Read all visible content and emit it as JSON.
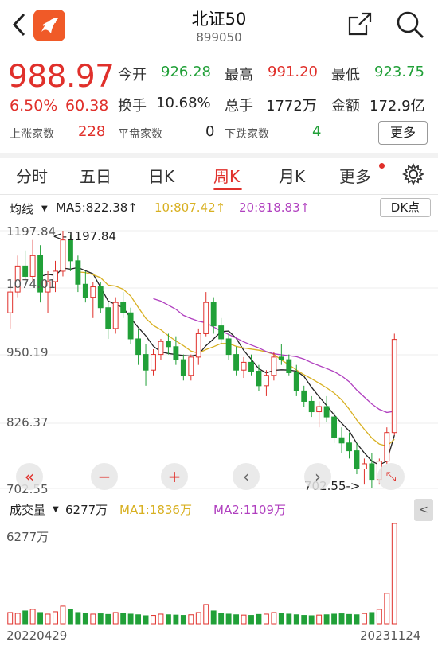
{
  "header": {
    "title": "北证50",
    "code": "899050"
  },
  "quote": {
    "price": "988.97",
    "change_pct": "6.50%",
    "change_abs": "60.38",
    "open_label": "今开",
    "open": "926.28",
    "high_label": "最高",
    "high": "991.20",
    "low_label": "最低",
    "low": "923.75",
    "turnover_label": "换手",
    "turnover": "10.68%",
    "volume_label": "总手",
    "volume": "1772万",
    "amount_label": "金额",
    "amount": "172.9亿",
    "up_label": "上涨家数",
    "up": "228",
    "flat_label": "平盘家数",
    "flat": "0",
    "down_label": "下跌家数",
    "down": "4",
    "more_label": "更多"
  },
  "tabs": [
    "分时",
    "五日",
    "日K",
    "周K",
    "月K",
    "更多"
  ],
  "active_tab": "周K",
  "indicators": {
    "selector": "均线",
    "ma5": "MA5:822.38↑",
    "ma10": "10:807.42↑",
    "ma20": "20:818.83↑",
    "dk": "DK点"
  },
  "chart_labels": {
    "y_top": "1197.84",
    "y2": "1074.01",
    "y3": "950.19",
    "y4": "826.37",
    "y_bottom": "702.55",
    "max_note": "<-1197.84",
    "min_note": "702.55->"
  },
  "volume": {
    "selector": "成交量",
    "value": "6277万",
    "ma1": "MA1:1836万",
    "ma2": "MA2:1109万",
    "axis_top": "6277万",
    "arrow": "<"
  },
  "dates": {
    "start": "20220429",
    "end": "20231124"
  },
  "controls": {
    "first": "«",
    "zoom_out": "−",
    "zoom_in": "+",
    "prev": "‹",
    "next": "›"
  },
  "colors": {
    "up": "#e0302b",
    "down": "#21a038",
    "ma5": "#222222",
    "ma10": "#d8b021",
    "ma20": "#b03fbf"
  },
  "chart_data": {
    "type": "candlestick",
    "ylim": [
      702.55,
      1197.84
    ],
    "ohlc": [
      [
        1040,
        1090,
        1010,
        1080
      ],
      [
        1080,
        1150,
        1070,
        1130
      ],
      [
        1130,
        1160,
        1100,
        1110
      ],
      [
        1110,
        1180,
        1100,
        1150
      ],
      [
        1150,
        1170,
        1060,
        1080
      ],
      [
        1080,
        1120,
        1040,
        1100
      ],
      [
        1100,
        1140,
        1080,
        1120
      ],
      [
        1120,
        1197.84,
        1110,
        1180
      ],
      [
        1180,
        1190,
        1120,
        1140
      ],
      [
        1140,
        1150,
        1080,
        1095
      ],
      [
        1095,
        1120,
        1060,
        1070
      ],
      [
        1070,
        1100,
        1030,
        1090
      ],
      [
        1090,
        1100,
        1040,
        1050
      ],
      [
        1050,
        1060,
        990,
        1010
      ],
      [
        1010,
        1070,
        1000,
        1060
      ],
      [
        1060,
        1080,
        1030,
        1040
      ],
      [
        1040,
        1050,
        980,
        990
      ],
      [
        990,
        1010,
        940,
        960
      ],
      [
        960,
        980,
        900,
        930
      ],
      [
        930,
        970,
        920,
        960
      ],
      [
        960,
        990,
        950,
        985
      ],
      [
        985,
        1000,
        960,
        975
      ],
      [
        975,
        995,
        940,
        950
      ],
      [
        950,
        960,
        910,
        920
      ],
      [
        920,
        960,
        910,
        955
      ],
      [
        955,
        1010,
        940,
        1000
      ],
      [
        1000,
        1080,
        995,
        1060
      ],
      [
        1060,
        1070,
        1000,
        1015
      ],
      [
        1015,
        1030,
        980,
        990
      ],
      [
        990,
        1000,
        950,
        960
      ],
      [
        960,
        975,
        920,
        930
      ],
      [
        930,
        955,
        915,
        945
      ],
      [
        945,
        960,
        920,
        928
      ],
      [
        928,
        940,
        890,
        900
      ],
      [
        900,
        930,
        880,
        920
      ],
      [
        920,
        965,
        910,
        955
      ],
      [
        955,
        980,
        940,
        950
      ],
      [
        950,
        960,
        920,
        925
      ],
      [
        925,
        940,
        880,
        890
      ],
      [
        890,
        900,
        860,
        870
      ],
      [
        870,
        880,
        840,
        850
      ],
      [
        850,
        870,
        820,
        860
      ],
      [
        860,
        880,
        830,
        840
      ],
      [
        840,
        850,
        790,
        800
      ],
      [
        800,
        820,
        770,
        790
      ],
      [
        790,
        810,
        760,
        775
      ],
      [
        775,
        790,
        730,
        740
      ],
      [
        740,
        760,
        710,
        750
      ],
      [
        750,
        770,
        702.55,
        720
      ],
      [
        720,
        760,
        710,
        755
      ],
      [
        755,
        820,
        750,
        810
      ],
      [
        810,
        1000,
        805,
        988.97
      ]
    ],
    "volume": [
      700,
      650,
      800,
      900,
      700,
      600,
      750,
      1100,
      900,
      700,
      650,
      600,
      620,
      580,
      700,
      650,
      600,
      560,
      500,
      520,
      600,
      560,
      540,
      520,
      560,
      700,
      1200,
      800,
      650,
      600,
      560,
      540,
      520,
      580,
      600,
      700,
      650,
      600,
      560,
      520,
      500,
      540,
      560,
      600,
      620,
      580,
      560,
      640,
      700,
      900,
      1900,
      6277
    ]
  }
}
